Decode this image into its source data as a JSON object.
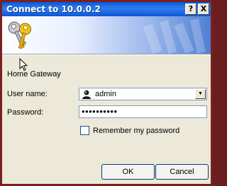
{
  "dialog": {
    "title": "Connect to 10.0.0.2",
    "help_label": "?",
    "close_label": "X",
    "realm": "Home Gateway",
    "username_label": "User name:",
    "username_value": "admin",
    "password_label": "Password:",
    "password_value": "••••••••••",
    "remember_label": "Remember my password",
    "remember_checked": false,
    "ok_label": "OK",
    "cancel_label": "Cancel"
  },
  "icons": {
    "banner": "keys-icon",
    "user": "user-icon",
    "dropdown": "chevron-down-icon",
    "cursor": "mouse-cursor-icon"
  },
  "colors": {
    "titlebar": "#0a58d8",
    "window_border": "#7a2020",
    "dialog_bg": "#ece9d8"
  }
}
